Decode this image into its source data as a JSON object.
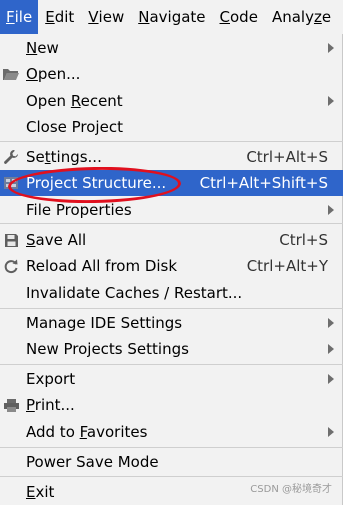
{
  "menubar": {
    "items": [
      {
        "mn": "F",
        "rest": "ile"
      },
      {
        "mn": "E",
        "rest": "dit"
      },
      {
        "mn": "V",
        "rest": "iew"
      },
      {
        "mn": "N",
        "rest": "avigate"
      },
      {
        "mn": "C",
        "rest": "ode"
      },
      {
        "pre": "Analy",
        "mn": "z",
        "rest": "e"
      }
    ]
  },
  "menu": {
    "new": {
      "mn": "N",
      "rest": "ew"
    },
    "open": {
      "mn": "O",
      "rest": "pen..."
    },
    "open_recent": {
      "pre": "Open ",
      "mn": "R",
      "rest": "ecent"
    },
    "close_project": {
      "label": "Close Project"
    },
    "settings": {
      "pre": "Se",
      "mn": "t",
      "rest": "tings...",
      "shortcut": "Ctrl+Alt+S"
    },
    "project_structure": {
      "label": "Project Structure...",
      "shortcut": "Ctrl+Alt+Shift+S"
    },
    "file_properties": {
      "label": "File Properties"
    },
    "save_all": {
      "mn": "S",
      "rest": "ave All",
      "shortcut": "Ctrl+S"
    },
    "reload": {
      "label": "Reload All from Disk",
      "shortcut": "Ctrl+Alt+Y"
    },
    "invalidate": {
      "label": "Invalidate Caches / Restart..."
    },
    "manage_ide": {
      "label": "Manage IDE Settings"
    },
    "new_projects_settings": {
      "label": "New Projects Settings"
    },
    "export": {
      "label": "Export"
    },
    "print": {
      "mn": "P",
      "rest": "rint..."
    },
    "add_favorites": {
      "pre": "Add to ",
      "mn": "F",
      "rest": "avorites"
    },
    "power_save": {
      "label": "Power Save Mode"
    },
    "exit": {
      "mn": "E",
      "rest": "xit"
    }
  },
  "watermark": "CSDN @秘境奇才",
  "colors": {
    "selection": "#2f65ca",
    "annotation": "#e0101e",
    "menu_bg": "#f2f2f2"
  }
}
